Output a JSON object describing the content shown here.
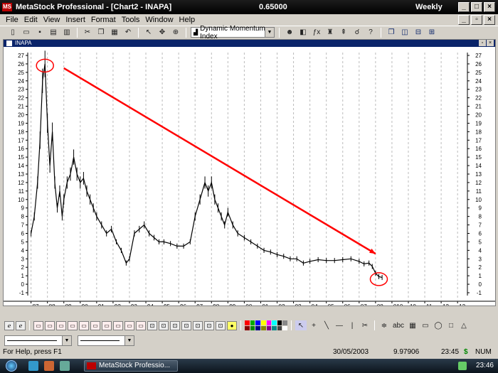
{
  "window": {
    "title": "MetaStock Professional - [Chart2 - INAPA]",
    "price": "0.65000",
    "period": "Weekly",
    "app_icon": "MS"
  },
  "menu": [
    "File",
    "Edit",
    "View",
    "Insert",
    "Format",
    "Tools",
    "Window",
    "Help"
  ],
  "toolbar": {
    "indicator_select": "Dynamic Momentum Index"
  },
  "chart_window": {
    "title": "INAPA"
  },
  "chart_data": {
    "type": "line",
    "title": "",
    "xlabel": "",
    "ylabel": "",
    "x_ticks": [
      "87",
      "88",
      "89",
      "90",
      "91",
      "92",
      "93",
      "94",
      "95",
      "96",
      "97",
      "98",
      "99",
      "00",
      "01",
      "02",
      "03",
      "04",
      "05",
      "06",
      "07",
      "08",
      "010",
      "10",
      "11",
      "12",
      "13"
    ],
    "y_ticks": [
      -1,
      0,
      1,
      2,
      3,
      4,
      5,
      6,
      7,
      8,
      9,
      10,
      11,
      12,
      13,
      14,
      15,
      16,
      17,
      18,
      19,
      20,
      21,
      22,
      23,
      24,
      25,
      26,
      27
    ],
    "ylim": [
      -1,
      27
    ],
    "grid": "vertical dashed",
    "series": [
      {
        "color": "#000000",
        "x": [
          1987.0,
          1987.2,
          1987.4,
          1987.55,
          1987.7,
          1987.85,
          1988.0,
          1988.15,
          1988.3,
          1988.45,
          1988.6,
          1988.75,
          1988.9,
          1989.0,
          1989.2,
          1989.4,
          1989.6,
          1989.8,
          1990.0,
          1990.2,
          1990.4,
          1990.6,
          1990.8,
          1991.0,
          1991.3,
          1991.6,
          1991.9,
          1992.2,
          1992.5,
          1992.8,
          1993.0,
          1993.3,
          1993.6,
          1993.9,
          1994.2,
          1994.5,
          1994.8,
          1995.1,
          1995.5,
          1995.9,
          1996.3,
          1996.7,
          1997.0,
          1997.3,
          1997.6,
          1997.8,
          1998.0,
          1998.2,
          1998.4,
          1998.6,
          1998.8,
          1999.0,
          1999.3,
          1999.6,
          2000.0,
          2000.4,
          2000.8,
          2001.2,
          2001.6,
          2002.0,
          2002.4,
          2002.8,
          2003.2,
          2003.6,
          2004.0,
          2004.5,
          2005.0,
          2005.5,
          2006.0,
          2006.5,
          2007.0,
          2007.3,
          2007.6,
          2007.8,
          2008.0,
          2008.2,
          2008.4
        ],
        "values": [
          6,
          8,
          12,
          17,
          24,
          26,
          19,
          14,
          18,
          12,
          9,
          11,
          8,
          10,
          12,
          13,
          15,
          13,
          12,
          12.5,
          11,
          10,
          9,
          8,
          7,
          6,
          6.5,
          5,
          4,
          2.5,
          3,
          6,
          6.5,
          7,
          6,
          5.5,
          5,
          5,
          4.8,
          4.5,
          4.5,
          5,
          8,
          10,
          12,
          11,
          12,
          10,
          9,
          8,
          7,
          8.5,
          7,
          6,
          5.5,
          5,
          4.5,
          4,
          3.8,
          3.5,
          3.3,
          3,
          3,
          2.5,
          2.7,
          2.9,
          2.8,
          2.8,
          2.9,
          3.0,
          2.7,
          2.4,
          2.5,
          2.1,
          1.3,
          0.9,
          0.8
        ]
      }
    ],
    "annotations": [
      {
        "type": "trend-arrow",
        "color": "#ff0000",
        "from": [
          1989.0,
          25.5
        ],
        "to": [
          2008.0,
          3.6
        ]
      },
      {
        "type": "circle",
        "color": "#ff0000",
        "center": [
          1987.85,
          25.8
        ]
      },
      {
        "type": "circle",
        "color": "#ff0000",
        "center": [
          2008.2,
          0.6
        ]
      }
    ]
  },
  "drawing_toolbar": {
    "style_combo_1": "",
    "style_combo_2": "",
    "text_tool": "abc"
  },
  "status": {
    "help": "For Help, press F1",
    "date": "30/05/2003",
    "value": "9.97906",
    "time": "23:45",
    "currency": "$",
    "num": "NUM"
  },
  "taskbar": {
    "item": "MetaStock Professio...",
    "clock": "23:46"
  },
  "colors": {
    "titlebar": "#000000",
    "chart_background": "#ffffff",
    "annotation": "#ff0000",
    "chart_header": "#0a246a"
  }
}
